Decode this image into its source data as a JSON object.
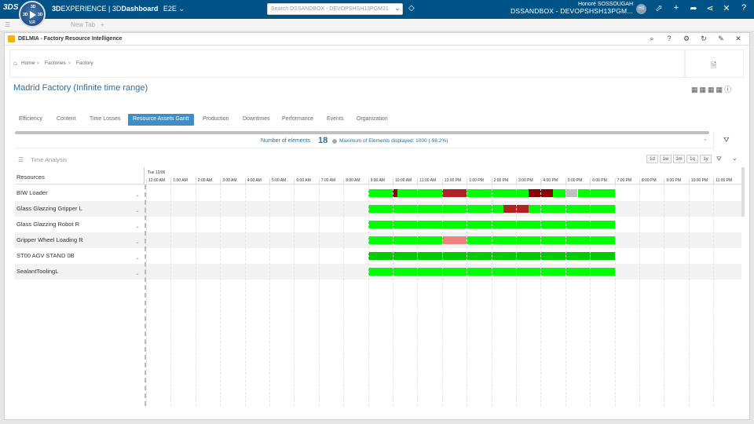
{
  "topbar": {
    "ds_logo": "3DS",
    "compass": {
      "top": "3D",
      "left": "3D",
      "right": "3D",
      "bottom": "V,R"
    },
    "brand_3d": "3D",
    "brand_experience": "EXPERIENCE | 3D",
    "brand_dashboard": "Dashboard",
    "brand_tenant": "E2E",
    "search_placeholder": "Search DSSANDBOX - DEVOPSHSH13PGM31",
    "user_name": "Honoré SOSSOUGAH",
    "user_credential": "DSSANDBOX - DEVOPSHSH13PGM...",
    "avatar_initials": "HS",
    "colors": {
      "bar": "#005386"
    }
  },
  "subbar": {
    "tab_label": "New Tab"
  },
  "window": {
    "title": "DELMIA - Factory Resource Intelligence"
  },
  "breadcrumb": {
    "items": [
      "Home",
      "Factories",
      "Factory"
    ]
  },
  "page_title": "Madrid Factory (Infinite time range)",
  "tabs": [
    {
      "label": "Efficiency",
      "active": false
    },
    {
      "label": "Content",
      "active": false
    },
    {
      "label": "Time Losses",
      "active": false
    },
    {
      "label": "Resource Assets Gantt",
      "active": true
    },
    {
      "label": "Production",
      "active": false
    },
    {
      "label": "Downtimes",
      "active": false
    },
    {
      "label": "Performance",
      "active": false
    },
    {
      "label": "Events",
      "active": false
    },
    {
      "label": "Organization",
      "active": false
    }
  ],
  "elements": {
    "label": "Number of elements",
    "count": "18",
    "max_text": "Maximum of Elements displayed: 1000 (-98.2%)"
  },
  "time_analysis": {
    "label": "Time Analysis",
    "zoom_buttons": [
      "1d",
      "1w",
      "1m",
      "1q",
      "1y"
    ]
  },
  "gantt": {
    "resources_header": "Resources",
    "day_label": "Tue 12/06",
    "hours": [
      "12:00 AM",
      "1:00 AM",
      "2:00 AM",
      "3:00 AM",
      "4:00 AM",
      "5:00 AM",
      "6:00 AM",
      "7:00 AM",
      "8:00 AM",
      "9:00 AM",
      "10:00 AM",
      "11:00 AM",
      "12:00 PM",
      "1:00 PM",
      "2:00 PM",
      "3:00 PM",
      "4:00 PM",
      "5:00 PM",
      "6:00 PM",
      "7:00 PM",
      "8:00 PM",
      "9:00 PM",
      "10:00 PM",
      "11:00 PM"
    ],
    "status_colors": {
      "running": "#00ff00",
      "running_dark": "#00cc00",
      "stopped": "#b22222",
      "fault": "#8b0000",
      "idle": "#c0c0c0",
      "warning": "#f08080"
    },
    "rows": [
      {
        "name": "BIW Loader",
        "segments": [
          {
            "start": 9.0,
            "end": 10.0,
            "status": "running"
          },
          {
            "start": 10.0,
            "end": 10.2,
            "status": "fault"
          },
          {
            "start": 10.2,
            "end": 12.0,
            "status": "running"
          },
          {
            "start": 12.0,
            "end": 13.0,
            "status": "stopped"
          },
          {
            "start": 13.0,
            "end": 15.5,
            "status": "running"
          },
          {
            "start": 15.5,
            "end": 16.5,
            "status": "fault"
          },
          {
            "start": 16.5,
            "end": 17.0,
            "status": "running"
          },
          {
            "start": 17.0,
            "end": 17.5,
            "status": "idle"
          },
          {
            "start": 17.5,
            "end": 19.0,
            "status": "running"
          }
        ]
      },
      {
        "name": "Glass Glazzing Gripper L",
        "segments": [
          {
            "start": 9.0,
            "end": 14.5,
            "status": "running"
          },
          {
            "start": 14.5,
            "end": 15.5,
            "status": "stopped"
          },
          {
            "start": 15.5,
            "end": 19.0,
            "status": "running"
          }
        ]
      },
      {
        "name": "Glass Glazzing Robot R",
        "segments": [
          {
            "start": 9.0,
            "end": 19.0,
            "status": "running"
          }
        ]
      },
      {
        "name": "Gripper Wheel Loading R",
        "segments": [
          {
            "start": 9.0,
            "end": 12.0,
            "status": "running"
          },
          {
            "start": 12.0,
            "end": 13.0,
            "status": "warning"
          },
          {
            "start": 13.0,
            "end": 19.0,
            "status": "running"
          }
        ]
      },
      {
        "name": "ST00 AGV STAND 0B",
        "segments": [
          {
            "start": 9.0,
            "end": 19.0,
            "status": "running_dark"
          }
        ]
      },
      {
        "name": "SealantToolingL",
        "segments": [
          {
            "start": 9.0,
            "end": 19.0,
            "status": "running"
          }
        ]
      }
    ]
  }
}
